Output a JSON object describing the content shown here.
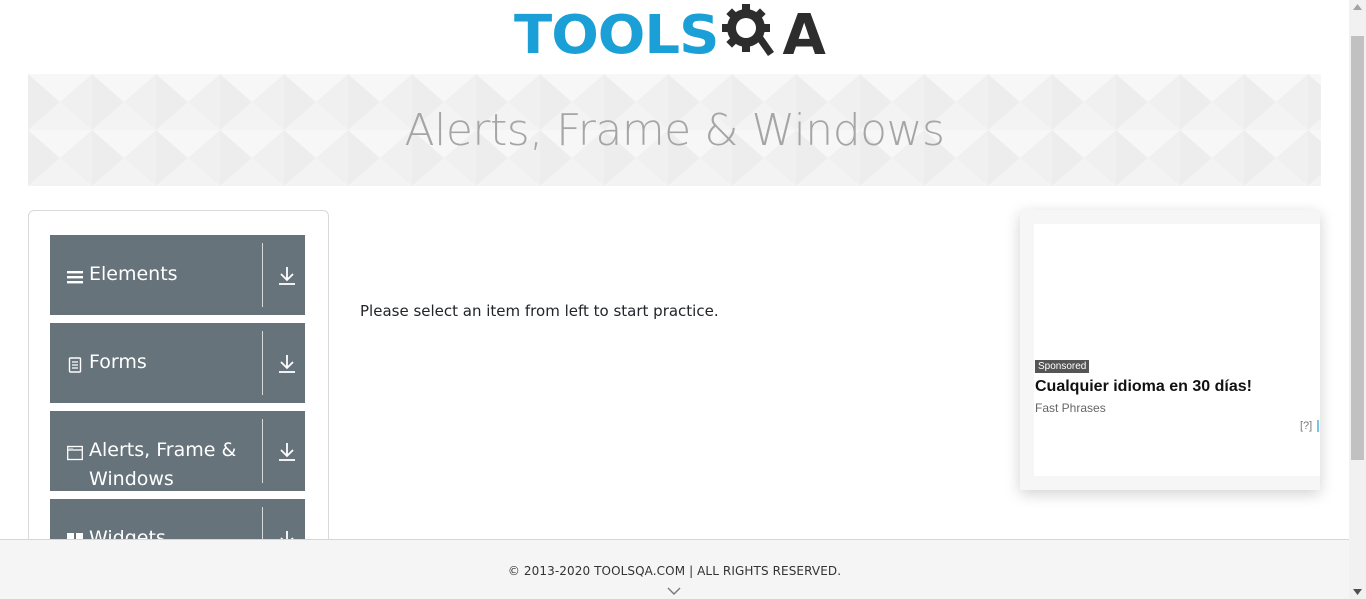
{
  "logo": {
    "part1": "TOOLS",
    "part2": "A"
  },
  "banner": {
    "title": "Alerts, Frame & Windows"
  },
  "sidebar": {
    "groups": [
      {
        "icon": "menu-icon",
        "label": "Elements"
      },
      {
        "icon": "form-icon",
        "label": "Forms"
      },
      {
        "icon": "window-icon",
        "label": "Alerts, Frame &",
        "label2": "Windows"
      },
      {
        "icon": "widgets-icon",
        "label": "Widgets"
      }
    ],
    "download_icon": "download-icon"
  },
  "main": {
    "message": "Please select an item from left to start practice."
  },
  "ad": {
    "sponsored": "Sponsored",
    "headline": "Cualquier idioma en 30 días!",
    "advertiser": "Fast Phrases",
    "help": "[?]",
    "choices_icon": "adchoices-icon"
  },
  "footer": {
    "text": "© 2013-2020 TOOLSQA.COM | ALL RIGHTS RESERVED."
  },
  "colors": {
    "brand_blue": "#1a9fd6",
    "brand_dark": "#2d2d2d",
    "group_bg": "#66737b",
    "banner_title": "#a5a5a5"
  }
}
